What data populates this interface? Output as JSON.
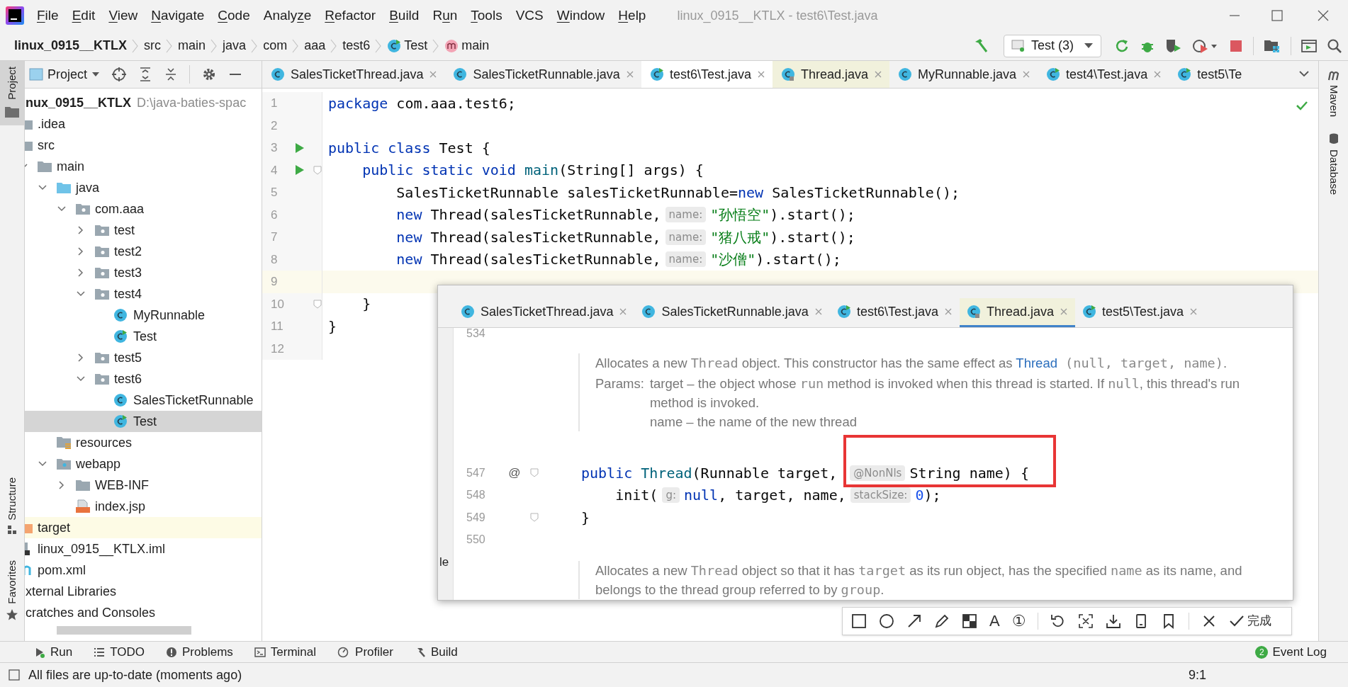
{
  "window": {
    "title": "linux_0915__KTLX - test6\\Test.java"
  },
  "menu": [
    {
      "key": "F",
      "post": "ile"
    },
    {
      "key": "E",
      "post": "dit"
    },
    {
      "key": "V",
      "post": "iew"
    },
    {
      "key": "N",
      "post": "avigate"
    },
    {
      "key": "C",
      "post": "ode"
    },
    {
      "pre": "Analy",
      "key": "z",
      "post": "e"
    },
    {
      "key": "R",
      "post": "efactor"
    },
    {
      "key": "B",
      "post": "uild"
    },
    {
      "pre": "R",
      "key": "u",
      "post": "n"
    },
    {
      "key": "T",
      "post": "ools"
    },
    {
      "pre": "VCS"
    },
    {
      "key": "W",
      "post": "indow"
    },
    {
      "key": "H",
      "post": "elp"
    }
  ],
  "breadcrumb": [
    {
      "label": "linux_0915__KTLX",
      "kind": "project"
    },
    {
      "label": "src",
      "kind": "folder"
    },
    {
      "label": "main",
      "kind": "folder"
    },
    {
      "label": "java",
      "kind": "folder"
    },
    {
      "label": "com",
      "kind": "folder"
    },
    {
      "label": "aaa",
      "kind": "folder"
    },
    {
      "label": "test6",
      "kind": "folder"
    },
    {
      "label": "Test",
      "kind": "class"
    },
    {
      "label": "main",
      "kind": "method"
    }
  ],
  "run_config": "Test (3)",
  "tool_windows_left": [
    {
      "label": "Project",
      "selected": true
    },
    {
      "label": "Structure",
      "selected": false
    },
    {
      "label": "Favorites",
      "selected": false
    }
  ],
  "tool_windows_right": [
    {
      "label": "Maven"
    },
    {
      "label": "Database"
    }
  ],
  "project_panel": {
    "title": "Project",
    "tree": [
      {
        "label": "nux_0915__KTLX",
        "path": "D:\\java-baties-spac",
        "kind": "module",
        "selected": false,
        "children": [
          {
            "label": ".idea",
            "kind": "folder",
            "selected": false
          },
          {
            "label": "src",
            "kind": "folder",
            "selected": false,
            "children": [
              {
                "label": "main",
                "kind": "folder",
                "expanded": true,
                "selected": false,
                "children": [
                  {
                    "label": "java",
                    "kind": "source",
                    "expanded": true,
                    "selected": false,
                    "children": [
                      {
                        "label": "com.aaa",
                        "kind": "package",
                        "expanded": true,
                        "selected": false,
                        "children": [
                          {
                            "label": "test",
                            "kind": "package",
                            "expanded": false,
                            "selected": false
                          },
                          {
                            "label": "test2",
                            "kind": "package",
                            "expanded": false,
                            "selected": false
                          },
                          {
                            "label": "test3",
                            "kind": "package",
                            "expanded": false,
                            "selected": false
                          },
                          {
                            "label": "test4",
                            "kind": "package",
                            "expanded": true,
                            "selected": false,
                            "children": [
                              {
                                "label": "MyRunnable",
                                "kind": "class",
                                "selected": false
                              },
                              {
                                "label": "Test",
                                "kind": "main_class",
                                "selected": false
                              }
                            ]
                          },
                          {
                            "label": "test5",
                            "kind": "package",
                            "expanded": false,
                            "selected": false
                          },
                          {
                            "label": "test6",
                            "kind": "package",
                            "expanded": true,
                            "selected": false,
                            "children": [
                              {
                                "label": "SalesTicketRunnable",
                                "kind": "class",
                                "selected": false
                              },
                              {
                                "label": "Test",
                                "kind": "main_class",
                                "selected": true
                              }
                            ]
                          }
                        ]
                      }
                    ]
                  },
                  {
                    "label": "resources",
                    "kind": "resources",
                    "selected": false
                  },
                  {
                    "label": "webapp",
                    "kind": "web",
                    "expanded": true,
                    "selected": false,
                    "children": [
                      {
                        "label": "WEB-INF",
                        "kind": "folder",
                        "expanded": false,
                        "selected": false
                      },
                      {
                        "label": "index.jsp",
                        "kind": "jsp",
                        "selected": false
                      }
                    ]
                  }
                ]
              }
            ]
          },
          {
            "label": "target",
            "kind": "excluded",
            "selected": false
          },
          {
            "label": "linux_0915__KTLX.iml",
            "kind": "iml",
            "selected": false
          },
          {
            "label": "pom.xml",
            "kind": "maven",
            "selected": false
          }
        ]
      },
      {
        "label": "xternal Libraries",
        "kind": "libraries",
        "selected": false
      },
      {
        "label": "cratches and Consoles",
        "kind": "scratches",
        "selected": false
      }
    ]
  },
  "editor_tabs": [
    {
      "label": "SalesTicketThread.java",
      "kind": "class",
      "selected": false,
      "closable": true
    },
    {
      "label": "SalesTicketRunnable.java",
      "kind": "class",
      "selected": false,
      "closable": true
    },
    {
      "label": "test6\\Test.java",
      "kind": "main_class",
      "selected": true,
      "closable": true
    },
    {
      "label": "Thread.java",
      "kind": "library",
      "selected": false,
      "closable": true
    },
    {
      "label": "MyRunnable.java",
      "kind": "class",
      "selected": false,
      "closable": true
    },
    {
      "label": "test4\\Test.java",
      "kind": "main_class",
      "selected": false,
      "closable": true
    },
    {
      "label": "test5\\Te",
      "kind": "main_class",
      "selected": false,
      "closable": false
    }
  ],
  "code": [
    {
      "number": "1",
      "run": false,
      "fold": false,
      "current": false,
      "tokens": [
        {
          "kind": "keyword",
          "text": "package"
        },
        {
          "kind": "plain",
          "text": " com.aaa.test6;"
        }
      ]
    },
    {
      "number": "2",
      "run": false,
      "fold": false,
      "current": false
    },
    {
      "number": "3",
      "run": true,
      "fold": false,
      "current": false,
      "tokens": [
        {
          "kind": "keyword",
          "text": "public class"
        },
        {
          "kind": "plain",
          "text": " Test {"
        }
      ]
    },
    {
      "number": "4",
      "run": true,
      "fold": true,
      "current": false,
      "tokens": [
        {
          "kind": "keyword",
          "text": "    public static void"
        },
        {
          "kind": "method",
          "text": " main"
        },
        {
          "kind": "plain",
          "text": "(String[] args) {"
        }
      ]
    },
    {
      "number": "5",
      "run": false,
      "fold": false,
      "current": false,
      "tokens": [
        {
          "kind": "plain",
          "text": "        SalesTicketRunnable salesTicketRunnable="
        },
        {
          "kind": "keyword",
          "text": "new"
        },
        {
          "kind": "plain",
          "text": " SalesTicketRunnable();"
        }
      ]
    },
    {
      "number": "6",
      "run": false,
      "fold": false,
      "current": false,
      "tokens": [
        {
          "kind": "keyword",
          "text": "        new"
        },
        {
          "kind": "plain",
          "text": " Thread(salesTicketRunnable,"
        },
        {
          "kind": "hint",
          "text": "name:"
        },
        {
          "kind": "string",
          "text": "\"孙悟空\""
        },
        {
          "kind": "plain",
          "text": ").start();"
        }
      ]
    },
    {
      "number": "7",
      "run": false,
      "fold": false,
      "current": false,
      "tokens": [
        {
          "kind": "keyword",
          "text": "        new"
        },
        {
          "kind": "plain",
          "text": " Thread(salesTicketRunnable,"
        },
        {
          "kind": "hint",
          "text": "name:"
        },
        {
          "kind": "string",
          "text": "\"猪八戒\""
        },
        {
          "kind": "plain",
          "text": ").start();"
        }
      ]
    },
    {
      "number": "8",
      "run": false,
      "fold": false,
      "current": false,
      "tokens": [
        {
          "kind": "keyword",
          "text": "        new"
        },
        {
          "kind": "plain",
          "text": " Thread(salesTicketRunnable,"
        },
        {
          "kind": "hint",
          "text": "name:"
        },
        {
          "kind": "string",
          "text": "\"沙僧\""
        },
        {
          "kind": "plain",
          "text": ").start();"
        }
      ]
    },
    {
      "number": "9",
      "run": false,
      "fold": false,
      "current": true
    },
    {
      "number": "10",
      "run": false,
      "fold": true,
      "current": false,
      "tokens": [
        {
          "kind": "plain",
          "text": "    }"
        }
      ]
    },
    {
      "number": "11",
      "run": false,
      "fold": false,
      "current": false,
      "tokens": [
        {
          "kind": "plain",
          "text": "}"
        }
      ]
    },
    {
      "number": "12",
      "run": false,
      "fold": false,
      "current": false
    }
  ],
  "popup": {
    "side_text": "le",
    "tabs": [
      {
        "label": "SalesTicketThread.java",
        "kind": "class",
        "selected": false
      },
      {
        "label": "SalesTicketRunnable.java",
        "kind": "class",
        "selected": false
      },
      {
        "label": "test6\\Test.java",
        "kind": "main_class",
        "selected": false
      },
      {
        "label": "Thread.java",
        "kind": "library",
        "selected": true
      },
      {
        "label": "test5\\Test.java",
        "kind": "main_class",
        "selected": false
      }
    ],
    "lines": [
      {
        "kind": "number_only",
        "number": "534"
      },
      {
        "kind": "doc",
        "text": [
          {
            "kind": "text",
            "text": "Allocates a new "
          },
          {
            "kind": "code",
            "text": "Thread"
          },
          {
            "kind": "text",
            "text": " object. This constructor has the same effect as "
          },
          {
            "kind": "link",
            "text": "Thread"
          },
          {
            "kind": "code",
            "text": " (null, target, name)"
          },
          {
            "kind": "text",
            "text": "."
          }
        ],
        "params": {
          "label": "Params:",
          "entries": [
            [
              {
                "kind": "text",
                "text": "target – the object whose "
              },
              {
                "kind": "code",
                "text": "run"
              },
              {
                "kind": "text",
                "text": " method is invoked when this thread is started. If "
              },
              {
                "kind": "code",
                "text": "null"
              },
              {
                "kind": "text",
                "text": ", this thread's run method is invoked."
              }
            ],
            [
              {
                "kind": "text",
                "text": "name – the name of the new thread"
              }
            ]
          ]
        }
      },
      {
        "kind": "code",
        "number": "547",
        "marker": "@",
        "fold": true,
        "tokens": [
          {
            "kind": "keyword",
            "text": "public"
          },
          {
            "kind": "method",
            "text": " Thread"
          },
          {
            "kind": "plain",
            "text": "(Runnable target, "
          },
          {
            "kind": "hint",
            "text": "@NonNls"
          },
          {
            "kind": "plain",
            "text": "String name) {"
          }
        ]
      },
      {
        "kind": "code",
        "number": "548",
        "fold": false,
        "tokens": [
          {
            "kind": "plain",
            "text": "    init("
          },
          {
            "kind": "hint",
            "text": "g:"
          },
          {
            "kind": "keyword",
            "text": "null"
          },
          {
            "kind": "plain",
            "text": ", target, name,"
          },
          {
            "kind": "hint",
            "text": "stackSize:"
          },
          {
            "kind": "number",
            "text": "0"
          },
          {
            "kind": "plain",
            "text": ");"
          }
        ]
      },
      {
        "kind": "code",
        "number": "549",
        "fold": true,
        "tokens": [
          {
            "kind": "plain",
            "text": "}"
          }
        ]
      },
      {
        "kind": "code",
        "number": "550",
        "fold": false
      },
      {
        "kind": "doc",
        "text": [
          {
            "kind": "text",
            "text": "Allocates a new "
          },
          {
            "kind": "code",
            "text": "Thread"
          },
          {
            "kind": "text",
            "text": " object so that it has "
          },
          {
            "kind": "code",
            "text": "target"
          },
          {
            "kind": "text",
            "text": " as its run object, has the specified "
          },
          {
            "kind": "code",
            "text": "name"
          },
          {
            "kind": "text",
            "text": " as its name, and belongs to the thread group referred to by "
          },
          {
            "kind": "code",
            "text": "group"
          },
          {
            "kind": "text",
            "text": "."
          }
        ]
      }
    ]
  },
  "capture_toolbar": {
    "text_tool": "A",
    "number_tool": "①",
    "confirm": "完成"
  },
  "bottom_tools": [
    {
      "label": "Run",
      "kind": "run"
    },
    {
      "label": "TODO",
      "kind": "todo"
    },
    {
      "label": "Problems",
      "kind": "problems"
    },
    {
      "label": "Terminal",
      "kind": "terminal"
    },
    {
      "label": "Profiler",
      "kind": "profiler"
    },
    {
      "label": "Build",
      "kind": "build"
    }
  ],
  "event_log": {
    "label": "Event Log",
    "count": "2"
  },
  "status_bar": {
    "message": "All files are up-to-date (moments ago)",
    "position": "9:1"
  }
}
